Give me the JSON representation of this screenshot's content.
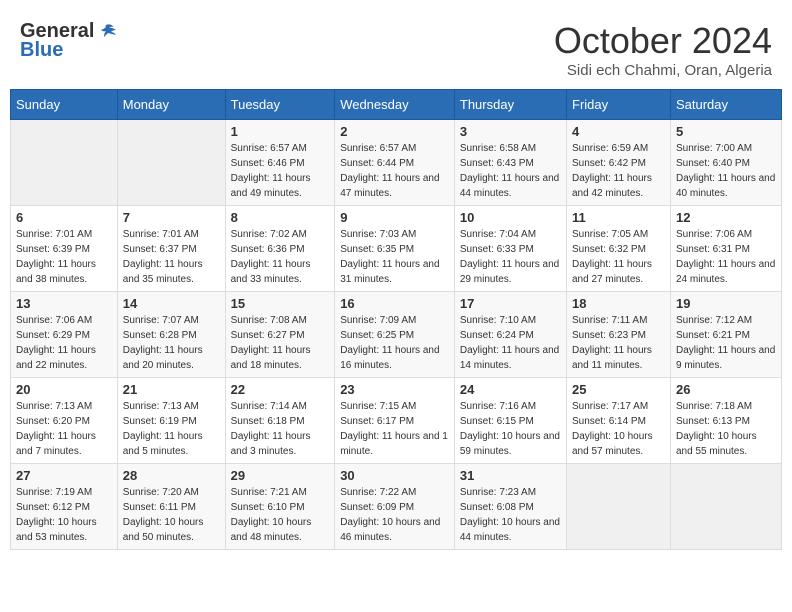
{
  "logo": {
    "line1": "General",
    "line2": "Blue"
  },
  "title": "October 2024",
  "location": "Sidi ech Chahmi, Oran, Algeria",
  "weekdays": [
    "Sunday",
    "Monday",
    "Tuesday",
    "Wednesday",
    "Thursday",
    "Friday",
    "Saturday"
  ],
  "weeks": [
    [
      {
        "day": "",
        "info": ""
      },
      {
        "day": "",
        "info": ""
      },
      {
        "day": "1",
        "info": "Sunrise: 6:57 AM\nSunset: 6:46 PM\nDaylight: 11 hours and 49 minutes."
      },
      {
        "day": "2",
        "info": "Sunrise: 6:57 AM\nSunset: 6:44 PM\nDaylight: 11 hours and 47 minutes."
      },
      {
        "day": "3",
        "info": "Sunrise: 6:58 AM\nSunset: 6:43 PM\nDaylight: 11 hours and 44 minutes."
      },
      {
        "day": "4",
        "info": "Sunrise: 6:59 AM\nSunset: 6:42 PM\nDaylight: 11 hours and 42 minutes."
      },
      {
        "day": "5",
        "info": "Sunrise: 7:00 AM\nSunset: 6:40 PM\nDaylight: 11 hours and 40 minutes."
      }
    ],
    [
      {
        "day": "6",
        "info": "Sunrise: 7:01 AM\nSunset: 6:39 PM\nDaylight: 11 hours and 38 minutes."
      },
      {
        "day": "7",
        "info": "Sunrise: 7:01 AM\nSunset: 6:37 PM\nDaylight: 11 hours and 35 minutes."
      },
      {
        "day": "8",
        "info": "Sunrise: 7:02 AM\nSunset: 6:36 PM\nDaylight: 11 hours and 33 minutes."
      },
      {
        "day": "9",
        "info": "Sunrise: 7:03 AM\nSunset: 6:35 PM\nDaylight: 11 hours and 31 minutes."
      },
      {
        "day": "10",
        "info": "Sunrise: 7:04 AM\nSunset: 6:33 PM\nDaylight: 11 hours and 29 minutes."
      },
      {
        "day": "11",
        "info": "Sunrise: 7:05 AM\nSunset: 6:32 PM\nDaylight: 11 hours and 27 minutes."
      },
      {
        "day": "12",
        "info": "Sunrise: 7:06 AM\nSunset: 6:31 PM\nDaylight: 11 hours and 24 minutes."
      }
    ],
    [
      {
        "day": "13",
        "info": "Sunrise: 7:06 AM\nSunset: 6:29 PM\nDaylight: 11 hours and 22 minutes."
      },
      {
        "day": "14",
        "info": "Sunrise: 7:07 AM\nSunset: 6:28 PM\nDaylight: 11 hours and 20 minutes."
      },
      {
        "day": "15",
        "info": "Sunrise: 7:08 AM\nSunset: 6:27 PM\nDaylight: 11 hours and 18 minutes."
      },
      {
        "day": "16",
        "info": "Sunrise: 7:09 AM\nSunset: 6:25 PM\nDaylight: 11 hours and 16 minutes."
      },
      {
        "day": "17",
        "info": "Sunrise: 7:10 AM\nSunset: 6:24 PM\nDaylight: 11 hours and 14 minutes."
      },
      {
        "day": "18",
        "info": "Sunrise: 7:11 AM\nSunset: 6:23 PM\nDaylight: 11 hours and 11 minutes."
      },
      {
        "day": "19",
        "info": "Sunrise: 7:12 AM\nSunset: 6:21 PM\nDaylight: 11 hours and 9 minutes."
      }
    ],
    [
      {
        "day": "20",
        "info": "Sunrise: 7:13 AM\nSunset: 6:20 PM\nDaylight: 11 hours and 7 minutes."
      },
      {
        "day": "21",
        "info": "Sunrise: 7:13 AM\nSunset: 6:19 PM\nDaylight: 11 hours and 5 minutes."
      },
      {
        "day": "22",
        "info": "Sunrise: 7:14 AM\nSunset: 6:18 PM\nDaylight: 11 hours and 3 minutes."
      },
      {
        "day": "23",
        "info": "Sunrise: 7:15 AM\nSunset: 6:17 PM\nDaylight: 11 hours and 1 minute."
      },
      {
        "day": "24",
        "info": "Sunrise: 7:16 AM\nSunset: 6:15 PM\nDaylight: 10 hours and 59 minutes."
      },
      {
        "day": "25",
        "info": "Sunrise: 7:17 AM\nSunset: 6:14 PM\nDaylight: 10 hours and 57 minutes."
      },
      {
        "day": "26",
        "info": "Sunrise: 7:18 AM\nSunset: 6:13 PM\nDaylight: 10 hours and 55 minutes."
      }
    ],
    [
      {
        "day": "27",
        "info": "Sunrise: 7:19 AM\nSunset: 6:12 PM\nDaylight: 10 hours and 53 minutes."
      },
      {
        "day": "28",
        "info": "Sunrise: 7:20 AM\nSunset: 6:11 PM\nDaylight: 10 hours and 50 minutes."
      },
      {
        "day": "29",
        "info": "Sunrise: 7:21 AM\nSunset: 6:10 PM\nDaylight: 10 hours and 48 minutes."
      },
      {
        "day": "30",
        "info": "Sunrise: 7:22 AM\nSunset: 6:09 PM\nDaylight: 10 hours and 46 minutes."
      },
      {
        "day": "31",
        "info": "Sunrise: 7:23 AM\nSunset: 6:08 PM\nDaylight: 10 hours and 44 minutes."
      },
      {
        "day": "",
        "info": ""
      },
      {
        "day": "",
        "info": ""
      }
    ]
  ]
}
